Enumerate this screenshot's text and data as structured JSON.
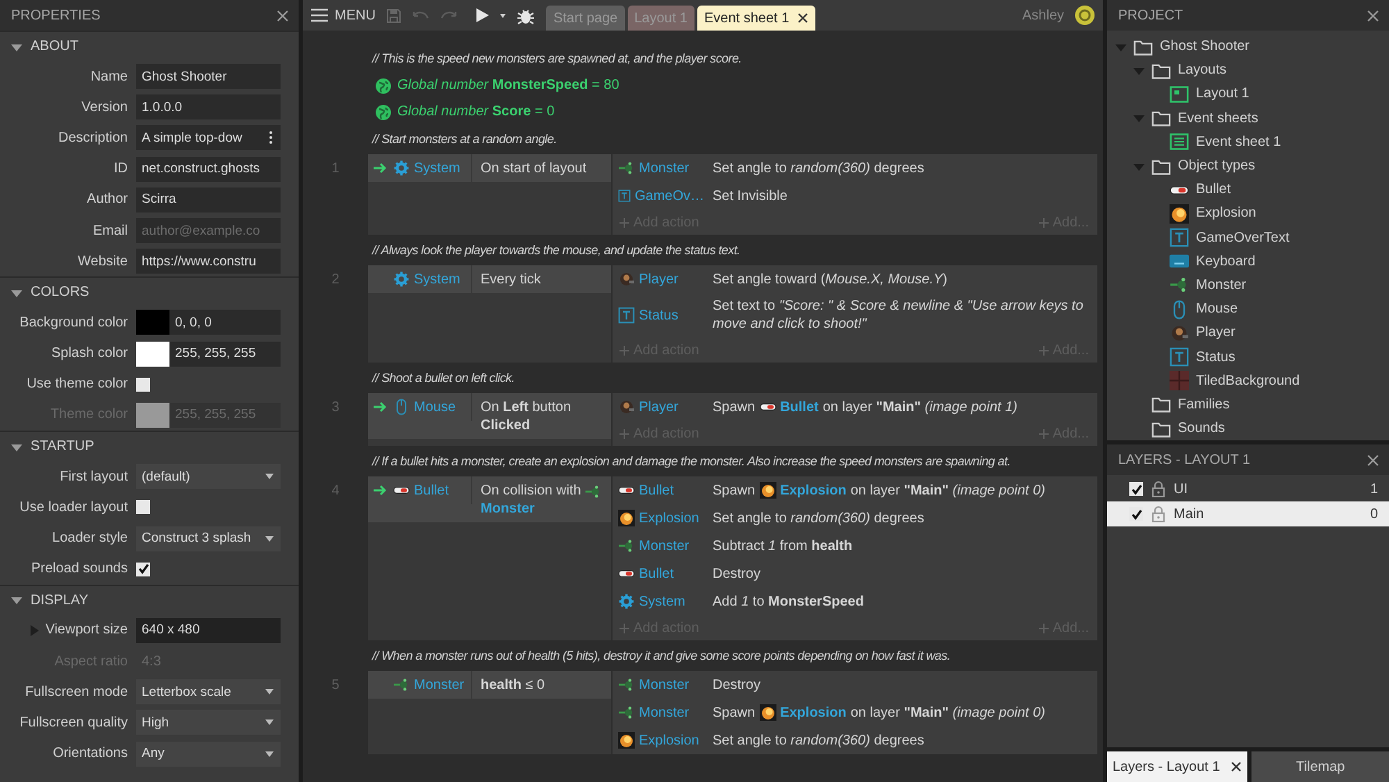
{
  "properties": {
    "title": "PROPERTIES",
    "sections": [
      {
        "title": "ABOUT",
        "expanded": true,
        "rows": [
          {
            "kind": "text",
            "label": "Name",
            "value": "Ghost Shooter",
            "disabled": false
          },
          {
            "kind": "text",
            "label": "Version",
            "value": "1.0.0.0",
            "disabled": false
          },
          {
            "kind": "more",
            "label": "Description",
            "value": "A simple top-dow",
            "disabled": false
          },
          {
            "kind": "text",
            "label": "ID",
            "value": "net.construct.ghosts",
            "disabled": false
          },
          {
            "kind": "text",
            "label": "Author",
            "value": "Scirra",
            "disabled": false
          },
          {
            "kind": "text",
            "label": "Email",
            "placeholder": "author@example.co",
            "disabled": false
          },
          {
            "kind": "text",
            "label": "Website",
            "value": "https://www.constru",
            "disabled": false
          }
        ]
      },
      {
        "title": "COLORS",
        "expanded": true,
        "rows": [
          {
            "kind": "color",
            "label": "Background color",
            "value": "0, 0, 0",
            "color": "#000000",
            "disabled": false
          },
          {
            "kind": "color",
            "label": "Splash color",
            "value": "255, 255, 255",
            "color": "#ffffff",
            "disabled": false
          },
          {
            "kind": "check",
            "label": "Use theme color",
            "checked": false,
            "disabled": false
          },
          {
            "kind": "color",
            "label": "Theme color",
            "value": "255, 255, 255",
            "color": "#999999",
            "disabled": true
          }
        ]
      },
      {
        "title": "STARTUP",
        "expanded": true,
        "rows": [
          {
            "kind": "select",
            "label": "First layout",
            "value": "(default)",
            "disabled": false
          },
          {
            "kind": "check",
            "label": "Use loader layout",
            "checked": false,
            "disabled": false
          },
          {
            "kind": "select",
            "label": "Loader style",
            "value": "Construct 3 splash",
            "disabled": false
          },
          {
            "kind": "check",
            "label": "Preload sounds",
            "checked": true,
            "disabled": false
          }
        ]
      },
      {
        "title": "DISPLAY",
        "expanded": true,
        "rows": [
          {
            "kind": "group",
            "label": "Viewport size",
            "value": "640 x 480",
            "disabled": false
          },
          {
            "kind": "static",
            "label": "Aspect ratio",
            "value": "4:3",
            "disabled": true
          },
          {
            "kind": "select",
            "label": "Fullscreen mode",
            "value": "Letterbox scale",
            "disabled": false
          },
          {
            "kind": "select",
            "label": "Fullscreen quality",
            "value": "High",
            "disabled": false
          },
          {
            "kind": "select",
            "label": "Orientations",
            "value": "Any",
            "disabled": false
          }
        ]
      }
    ]
  },
  "toolbar": {
    "menu": "MENU",
    "tabs": [
      {
        "label": "Start page",
        "selected": false,
        "color": "#5e5e5e"
      },
      {
        "label": "Layout 1",
        "selected": false,
        "color": "#7a6565"
      },
      {
        "label": "Event sheet 1",
        "selected": true,
        "color": "#fbf1c7"
      }
    ],
    "user": "Ashley"
  },
  "sheet": [
    {
      "kind": "comment",
      "text": "//  This is the speed new monsters are spawned at, and the player score."
    },
    {
      "kind": "global",
      "text": "*Global number* **MonsterSpeed** = 80"
    },
    {
      "kind": "global",
      "text": "*Global number* **Score** = 0"
    },
    {
      "kind": "comment",
      "text": "//  Start monsters at a random angle."
    },
    {
      "kind": "event",
      "number": "1",
      "trigger": true,
      "conditions": [
        {
          "kind": "system",
          "object": "System",
          "text": "On start of layout"
        }
      ],
      "actions": [
        {
          "kind": "monster",
          "object": "Monster",
          "text": "Set angle to *random(360)* degrees"
        },
        {
          "kind": "text",
          "object": "GameOv…",
          "text": "Set Invisible"
        }
      ],
      "add_action": "Add action",
      "add_other": "Add..."
    },
    {
      "kind": "comment",
      "text": "//  Always look the player towards the mouse, and update the status text."
    },
    {
      "kind": "event",
      "number": "2",
      "trigger": false,
      "conditions": [
        {
          "kind": "system",
          "object": "System",
          "text": "Every tick"
        }
      ],
      "actions": [
        {
          "kind": "player",
          "object": "Player",
          "text": "Set angle toward (*Mouse.X, Mouse.Y*)"
        },
        {
          "kind": "text",
          "object": "Status",
          "text": "Set text to *\"Score: \" & Score & newline & \"Use arrow keys to move and click to shoot!\"*"
        }
      ],
      "add_action": "Add action",
      "add_other": "Add..."
    },
    {
      "kind": "comment",
      "text": "//  Shoot a bullet on left click."
    },
    {
      "kind": "event",
      "number": "3",
      "trigger": true,
      "conditions": [
        {
          "kind": "mouse",
          "object": "Mouse",
          "text": "On **Left** button **Clicked**"
        }
      ],
      "actions": [
        {
          "kind": "player",
          "object": "Player",
          "text": "Spawn",
          "target": {
            "kind": "bullet",
            "name": "Bullet"
          },
          "rest": "on layer **\"Main\"** *(image point 1)*"
        }
      ],
      "add_action": "Add action",
      "add_other": "Add..."
    },
    {
      "kind": "comment",
      "text": "//  If a bullet hits a monster, create an explosion and damage the monster.  Also increase the speed monsters are spawning at."
    },
    {
      "kind": "event",
      "number": "4",
      "trigger": true,
      "conditions": [
        {
          "kind": "bullet",
          "object": "Bullet",
          "text": "On collision with",
          "target": {
            "kind": "monster",
            "name": "Monster"
          }
        }
      ],
      "actions": [
        {
          "kind": "bullet",
          "object": "Bullet",
          "text": "Spawn",
          "target": {
            "kind": "explosion",
            "name": "Explosion"
          },
          "rest": "on layer **\"Main\"** *(image point 0)*"
        },
        {
          "kind": "explosion",
          "object": "Explosion",
          "text": "Set angle to *random(360)* degrees"
        },
        {
          "kind": "monster",
          "object": "Monster",
          "text": "Subtract *1* from **health**"
        },
        {
          "kind": "bullet",
          "object": "Bullet",
          "text": "Destroy"
        },
        {
          "kind": "system",
          "object": "System",
          "text": "Add *1* to **MonsterSpeed**"
        }
      ],
      "add_action": "Add action",
      "add_other": "Add..."
    },
    {
      "kind": "comment",
      "text": "//  When a monster runs out of health (5 hits), destroy it and give some score points depending on how fast it was."
    },
    {
      "kind": "event",
      "number": "5",
      "trigger": false,
      "conditions": [
        {
          "kind": "monster",
          "object": "Monster",
          "text": "**health** ≤ 0"
        }
      ],
      "actions": [
        {
          "kind": "monster",
          "object": "Monster",
          "text": "Destroy"
        },
        {
          "kind": "monster",
          "object": "Monster",
          "text": "Spawn",
          "target": {
            "kind": "explosion",
            "name": "Explosion"
          },
          "rest": "on layer **\"Main\"** *(image point 0)*"
        },
        {
          "kind": "explosion",
          "object": "Explosion",
          "text": "Set angle to *random(360)* degrees"
        }
      ]
    }
  ],
  "project": {
    "title": "PROJECT",
    "tree": [
      {
        "label": "Ghost Shooter",
        "kind": "folder",
        "expanded": true,
        "children": [
          {
            "label": "Layouts",
            "kind": "folder",
            "expanded": true,
            "children": [
              {
                "label": "Layout 1",
                "kind": "layout"
              }
            ]
          },
          {
            "label": "Event sheets",
            "kind": "folder",
            "expanded": true,
            "children": [
              {
                "label": "Event sheet 1",
                "kind": "sheet"
              }
            ]
          },
          {
            "label": "Object types",
            "kind": "folder",
            "expanded": true,
            "children": [
              {
                "label": "Bullet",
                "kind": "bullet"
              },
              {
                "label": "Explosion",
                "kind": "explosion"
              },
              {
                "label": "GameOverText",
                "kind": "text"
              },
              {
                "label": "Keyboard",
                "kind": "keyboard"
              },
              {
                "label": "Monster",
                "kind": "monster"
              },
              {
                "label": "Mouse",
                "kind": "mouse"
              },
              {
                "label": "Player",
                "kind": "player"
              },
              {
                "label": "Status",
                "kind": "text"
              },
              {
                "label": "TiledBackground",
                "kind": "tiled"
              }
            ]
          },
          {
            "label": "Families",
            "kind": "folder"
          },
          {
            "label": "Sounds",
            "kind": "folder"
          }
        ]
      }
    ]
  },
  "layers": {
    "title": "LAYERS - LAYOUT 1",
    "rows": [
      {
        "name": "UI",
        "number": "1",
        "visible": true,
        "selected": false
      },
      {
        "name": "Main",
        "number": "0",
        "visible": true,
        "selected": true
      }
    ]
  },
  "bottom_tabs": [
    {
      "label": "Layers - Layout 1",
      "selected": true
    },
    {
      "label": "Tilemap",
      "selected": false
    }
  ]
}
